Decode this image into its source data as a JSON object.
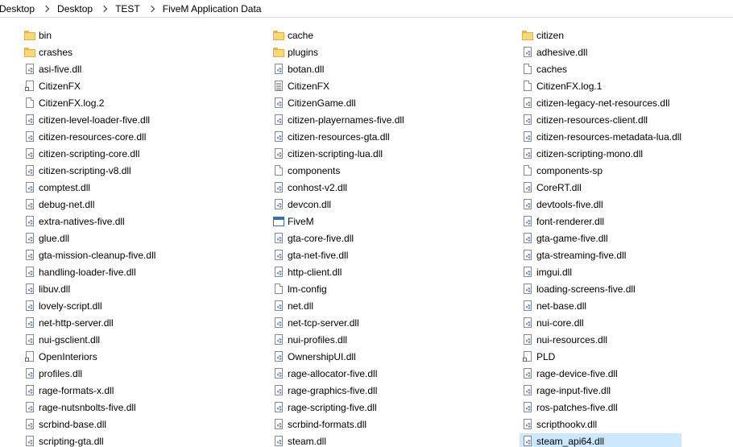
{
  "breadcrumb": [
    "Desktop",
    "Desktop",
    "TEST",
    "FiveM Application Data"
  ],
  "columns": [
    [
      {
        "name": "bin",
        "icon": "folder-icon"
      },
      {
        "name": "crashes",
        "icon": "folder-icon"
      },
      {
        "name": "asi-five.dll",
        "icon": "dll-icon"
      },
      {
        "name": "CitizenFX",
        "icon": "shortcut-icon"
      },
      {
        "name": "CitizenFX.log.2",
        "icon": "file-icon"
      },
      {
        "name": "citizen-level-loader-five.dll",
        "icon": "dll-icon"
      },
      {
        "name": "citizen-resources-core.dll",
        "icon": "dll-icon"
      },
      {
        "name": "citizen-scripting-core.dll",
        "icon": "dll-icon"
      },
      {
        "name": "citizen-scripting-v8.dll",
        "icon": "dll-icon"
      },
      {
        "name": "comptest.dll",
        "icon": "dll-icon"
      },
      {
        "name": "debug-net.dll",
        "icon": "dll-icon"
      },
      {
        "name": "extra-natives-five.dll",
        "icon": "dll-icon"
      },
      {
        "name": "glue.dll",
        "icon": "dll-icon"
      },
      {
        "name": "gta-mission-cleanup-five.dll",
        "icon": "dll-icon"
      },
      {
        "name": "handling-loader-five.dll",
        "icon": "dll-icon"
      },
      {
        "name": "libuv.dll",
        "icon": "dll-icon"
      },
      {
        "name": "lovely-script.dll",
        "icon": "dll-icon"
      },
      {
        "name": "net-http-server.dll",
        "icon": "dll-icon"
      },
      {
        "name": "nui-gsclient.dll",
        "icon": "dll-icon"
      },
      {
        "name": "OpenInteriors",
        "icon": "shortcut-icon"
      },
      {
        "name": "profiles.dll",
        "icon": "dll-icon"
      },
      {
        "name": "rage-formats-x.dll",
        "icon": "dll-icon"
      },
      {
        "name": "rage-nutsnbolts-five.dll",
        "icon": "dll-icon"
      },
      {
        "name": "scrbind-base.dll",
        "icon": "dll-icon"
      },
      {
        "name": "scripting-gta.dll",
        "icon": "dll-icon"
      }
    ],
    [
      {
        "name": "cache",
        "icon": "folder-icon"
      },
      {
        "name": "plugins",
        "icon": "folder-icon"
      },
      {
        "name": "botan.dll",
        "icon": "dll-icon"
      },
      {
        "name": "CitizenFX",
        "icon": "text-icon"
      },
      {
        "name": "CitizenGame.dll",
        "icon": "dll-icon"
      },
      {
        "name": "citizen-playernames-five.dll",
        "icon": "dll-icon"
      },
      {
        "name": "citizen-resources-gta.dll",
        "icon": "dll-icon"
      },
      {
        "name": "citizen-scripting-lua.dll",
        "icon": "dll-icon"
      },
      {
        "name": "components",
        "icon": "file-icon"
      },
      {
        "name": "conhost-v2.dll",
        "icon": "dll-icon"
      },
      {
        "name": "devcon.dll",
        "icon": "dll-icon"
      },
      {
        "name": "FiveM",
        "icon": "app-icon"
      },
      {
        "name": "gta-core-five.dll",
        "icon": "dll-icon"
      },
      {
        "name": "gta-net-five.dll",
        "icon": "dll-icon"
      },
      {
        "name": "http-client.dll",
        "icon": "dll-icon"
      },
      {
        "name": "lm-config",
        "icon": "file-icon"
      },
      {
        "name": "net.dll",
        "icon": "dll-icon"
      },
      {
        "name": "net-tcp-server.dll",
        "icon": "dll-icon"
      },
      {
        "name": "nui-profiles.dll",
        "icon": "dll-icon"
      },
      {
        "name": "OwnershipUI.dll",
        "icon": "dll-icon"
      },
      {
        "name": "rage-allocator-five.dll",
        "icon": "dll-icon"
      },
      {
        "name": "rage-graphics-five.dll",
        "icon": "dll-icon"
      },
      {
        "name": "rage-scripting-five.dll",
        "icon": "dll-icon"
      },
      {
        "name": "scrbind-formats.dll",
        "icon": "dll-icon"
      },
      {
        "name": "steam.dll",
        "icon": "dll-icon"
      }
    ],
    [
      {
        "name": "citizen",
        "icon": "folder-icon"
      },
      {
        "name": "adhesive.dll",
        "icon": "dll-icon"
      },
      {
        "name": "caches",
        "icon": "file-icon"
      },
      {
        "name": "CitizenFX.log.1",
        "icon": "file-icon"
      },
      {
        "name": "citizen-legacy-net-resources.dll",
        "icon": "dll-icon"
      },
      {
        "name": "citizen-resources-client.dll",
        "icon": "dll-icon"
      },
      {
        "name": "citizen-resources-metadata-lua.dll",
        "icon": "dll-icon"
      },
      {
        "name": "citizen-scripting-mono.dll",
        "icon": "dll-icon"
      },
      {
        "name": "components-sp",
        "icon": "file-icon"
      },
      {
        "name": "CoreRT.dll",
        "icon": "dll-icon"
      },
      {
        "name": "devtools-five.dll",
        "icon": "dll-icon"
      },
      {
        "name": "font-renderer.dll",
        "icon": "dll-icon"
      },
      {
        "name": "gta-game-five.dll",
        "icon": "dll-icon"
      },
      {
        "name": "gta-streaming-five.dll",
        "icon": "dll-icon"
      },
      {
        "name": "imgui.dll",
        "icon": "dll-icon"
      },
      {
        "name": "loading-screens-five.dll",
        "icon": "dll-icon"
      },
      {
        "name": "net-base.dll",
        "icon": "dll-icon"
      },
      {
        "name": "nui-core.dll",
        "icon": "dll-icon"
      },
      {
        "name": "nui-resources.dll",
        "icon": "dll-icon"
      },
      {
        "name": "PLD",
        "icon": "shortcut-icon"
      },
      {
        "name": "rage-device-five.dll",
        "icon": "dll-icon"
      },
      {
        "name": "rage-input-five.dll",
        "icon": "dll-icon"
      },
      {
        "name": "ros-patches-five.dll",
        "icon": "dll-icon"
      },
      {
        "name": "scripthookv.dll",
        "icon": "dll-icon"
      },
      {
        "name": "steam_api64.dll",
        "icon": "dll-icon",
        "selected": true
      }
    ]
  ]
}
